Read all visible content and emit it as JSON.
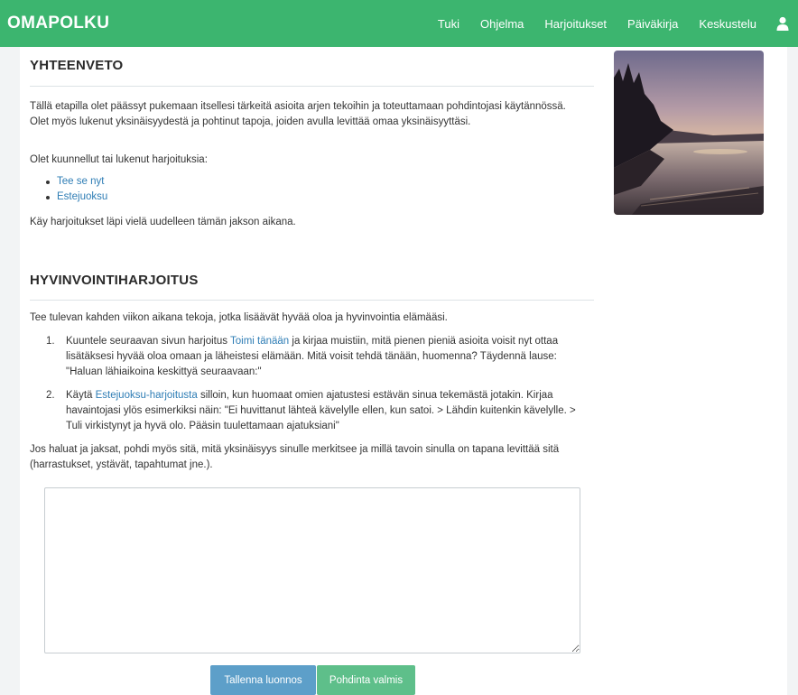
{
  "navbar": {
    "brand": "OMAPOLKU",
    "links": [
      "Tuki",
      "Ohjelma",
      "Harjoitukset",
      "Päiväkirja",
      "Keskustelu"
    ],
    "user_icon": "user-icon"
  },
  "summary": {
    "title": "YHTEENVETO",
    "intro": "Tällä etapilla olet päässyt pukemaan itsellesi tärkeitä asioita arjen tekoihin ja toteuttamaan pohdintojasi käytännössä. Olet myös lukenut yksinäisyydestä ja pohtinut tapoja, joiden avulla levittää omaa yksinäisyyttäsi.",
    "listened_label": "Olet kuunnellut tai lukenut harjoituksia:",
    "exercises": [
      "Tee se nyt",
      "Estejuoksu"
    ],
    "repeat_note": "Käy harjoitukset läpi vielä uudelleen tämän jakson aikana."
  },
  "wellbeing": {
    "title": "HYVINVOINTIHARJOITUS",
    "intro": "Tee tulevan kahden viikon aikana tekoja, jotka lisäävät hyvää oloa ja hyvinvointia elämääsi.",
    "step1_pre": "Kuuntele seuraavan sivun harjoitus ",
    "step1_link": "Toimi tänään",
    "step1_post": " ja kirjaa muistiin, mitä pienen pieniä asioita voisit nyt ottaa lisätäksesi hyvää oloa omaan ja läheistesi elämään. Mitä voisit tehdä tänään, huomenna? Täydennä lause: \"Haluan lähiaikoina keskittyä seuraavaan:\"",
    "step2_pre": "Käytä ",
    "step2_link": "Estejuoksu-harjoitusta",
    "step2_post": " silloin, kun huomaat omien ajatustesi estävän sinua tekemästä jotakin. Kirjaa havaintojasi ylös esimerkiksi näin: \"Ei huvittanut lähteä kävelylle ellen, kun satoi. > Lähdin kuitenkin kävelylle. > Tuli virkistynyt ja hyvä olo. Pääsin tuulettamaan ajatuksiani\"",
    "closing": "Jos haluat ja jaksat, pohdi myös sitä, mitä yksinäisyys sinulle merkitsee ja millä tavoin sinulla on tapana levittää sitä (harrastukset, ystävät, tapahtumat jne.).",
    "answer_value": ""
  },
  "buttons": {
    "save": "Tallenna luonnos",
    "finish": "Pohdinta valmis"
  },
  "colors": {
    "navbar": "#3cb56f",
    "link": "#2e7db5",
    "save_button": "#5d9fc9",
    "finish_button": "#5ebf8a"
  }
}
